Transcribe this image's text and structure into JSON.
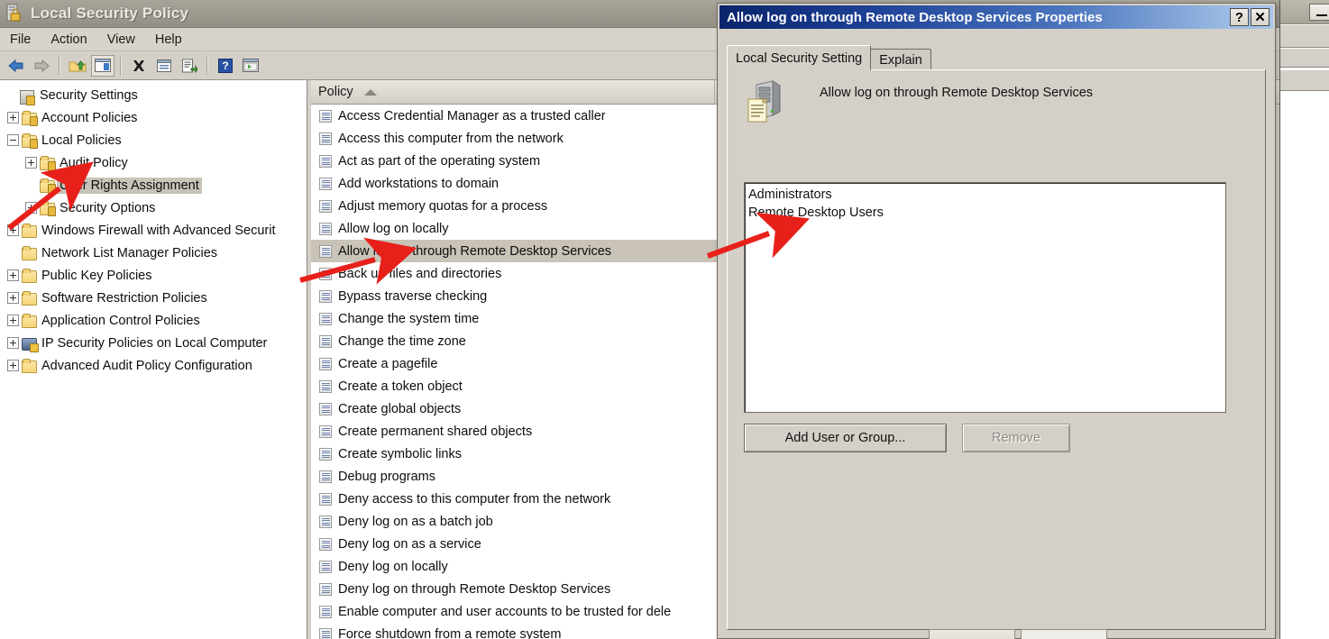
{
  "window": {
    "title": "Local Security Policy",
    "icon": "security-policy-icon",
    "menu": [
      "File",
      "Action",
      "View",
      "Help"
    ],
    "toolbar_icons": [
      "back-arrow-icon",
      "forward-arrow-icon",
      "up-folder-icon",
      "show-hide-tree-icon",
      "delete-icon",
      "properties-icon",
      "export-list-icon",
      "help-icon",
      "new-window-icon"
    ]
  },
  "background_window": {
    "minimize_label": "—"
  },
  "tree": {
    "items": [
      {
        "label": "Security Settings",
        "level": 0,
        "expander": "none",
        "icon": "security-settings-icon",
        "selected": false
      },
      {
        "label": "Account Policies",
        "level": 1,
        "expander": "plus",
        "icon": "folder-lock-icon",
        "selected": false
      },
      {
        "label": "Local Policies",
        "level": 1,
        "expander": "minus",
        "icon": "folder-lock-icon",
        "selected": false
      },
      {
        "label": "Audit Policy",
        "level": 2,
        "expander": "plus",
        "icon": "folder-lock-icon",
        "selected": false
      },
      {
        "label": "User Rights Assignment",
        "level": 2,
        "expander": "none",
        "icon": "folder-lock-icon",
        "selected": true
      },
      {
        "label": "Security Options",
        "level": 2,
        "expander": "plus",
        "icon": "folder-lock-icon",
        "selected": false
      },
      {
        "label": "Windows Firewall with Advanced Securit",
        "level": 1,
        "expander": "plus",
        "icon": "folder-icon",
        "selected": false
      },
      {
        "label": "Network List Manager Policies",
        "level": 1,
        "expander": "none",
        "icon": "folder-icon",
        "selected": false
      },
      {
        "label": "Public Key Policies",
        "level": 1,
        "expander": "plus",
        "icon": "folder-icon",
        "selected": false
      },
      {
        "label": "Software Restriction Policies",
        "level": 1,
        "expander": "plus",
        "icon": "folder-icon",
        "selected": false
      },
      {
        "label": "Application Control Policies",
        "level": 1,
        "expander": "plus",
        "icon": "folder-icon",
        "selected": false
      },
      {
        "label": "IP Security Policies on Local Computer",
        "level": 1,
        "expander": "plus",
        "icon": "ipsec-icon",
        "selected": false
      },
      {
        "label": "Advanced Audit Policy Configuration",
        "level": 1,
        "expander": "plus",
        "icon": "folder-icon",
        "selected": false
      }
    ]
  },
  "list": {
    "column_header": "Policy",
    "sort_direction": "ascending",
    "rows": [
      {
        "label": "Access Credential Manager as a trusted caller",
        "selected": false
      },
      {
        "label": "Access this computer from the network",
        "selected": false
      },
      {
        "label": "Act as part of the operating system",
        "selected": false
      },
      {
        "label": "Add workstations to domain",
        "selected": false
      },
      {
        "label": "Adjust memory quotas for a process",
        "selected": false
      },
      {
        "label": "Allow log on locally",
        "selected": false
      },
      {
        "label": "Allow log on through Remote Desktop Services",
        "selected": true
      },
      {
        "label": "Back up files and directories",
        "selected": false
      },
      {
        "label": "Bypass traverse checking",
        "selected": false
      },
      {
        "label": "Change the system time",
        "selected": false
      },
      {
        "label": "Change the time zone",
        "selected": false
      },
      {
        "label": "Create a pagefile",
        "selected": false
      },
      {
        "label": "Create a token object",
        "selected": false
      },
      {
        "label": "Create global objects",
        "selected": false
      },
      {
        "label": "Create permanent shared objects",
        "selected": false
      },
      {
        "label": "Create symbolic links",
        "selected": false
      },
      {
        "label": "Debug programs",
        "selected": false
      },
      {
        "label": "Deny access to this computer from the network",
        "selected": false
      },
      {
        "label": "Deny log on as a batch job",
        "selected": false
      },
      {
        "label": "Deny log on as a service",
        "selected": false
      },
      {
        "label": "Deny log on locally",
        "selected": false
      },
      {
        "label": "Deny log on through Remote Desktop Services",
        "selected": false
      },
      {
        "label": "Enable computer and user accounts to be trusted for dele",
        "selected": false
      },
      {
        "label": "Force shutdown from a remote system",
        "selected": false
      }
    ]
  },
  "dialog": {
    "title": "Allow log on through Remote Desktop Services Properties",
    "help_button": "?",
    "close_button": "✕",
    "tabs": [
      {
        "label": "Local Security Setting",
        "active": true
      },
      {
        "label": "Explain",
        "active": false
      }
    ],
    "policy_name": "Allow log on through Remote Desktop Services",
    "icon": "computer-policy-icon",
    "assigned": [
      "Administrators",
      "Remote Desktop Users"
    ],
    "buttons": [
      {
        "label": "Add User or Group...",
        "enabled": true
      },
      {
        "label": "Remove",
        "enabled": false
      }
    ]
  },
  "colors": {
    "title_bar_start": "#0a246a",
    "title_bar_end": "#a8c6ea",
    "dialog_face": "#d4d0c8",
    "selection": "#c9c3b8",
    "annotation_arrow": "#e8201a",
    "main_title_bar": "#9c988e"
  },
  "annotations": [
    {
      "name": "arrow-to-user-rights-assignment",
      "target": "User Rights Assignment"
    },
    {
      "name": "arrow-to-selected-policy",
      "target": "Allow log on through Remote Desktop Services"
    },
    {
      "name": "arrow-to-remote-desktop-users",
      "target": "Remote Desktop Users"
    }
  ]
}
